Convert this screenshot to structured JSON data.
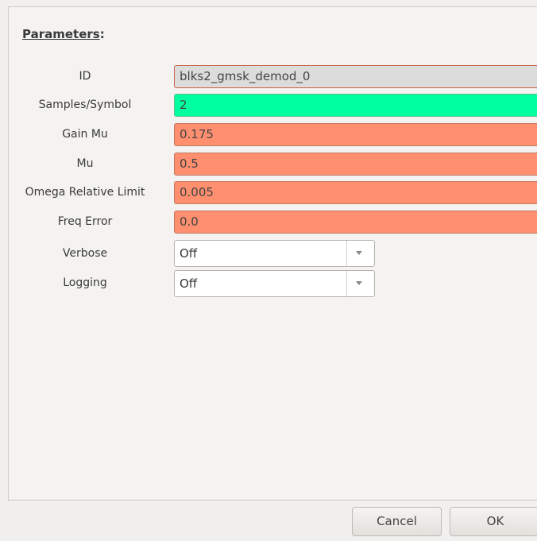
{
  "section_title_main": "Parameters",
  "section_title_colon": ":",
  "params": [
    {
      "label": "ID",
      "value": "blks2_gmsk_demod_0",
      "style": "id"
    },
    {
      "label": "Samples/Symbol",
      "value": "2",
      "style": "green"
    },
    {
      "label": "Gain Mu",
      "value": "0.175",
      "style": "orange"
    },
    {
      "label": "Mu",
      "value": "0.5",
      "style": "orange"
    },
    {
      "label": "Omega Relative Limit",
      "value": "0.005",
      "style": "orange"
    },
    {
      "label": "Freq Error",
      "value": "0.0",
      "style": "orange"
    }
  ],
  "verbose": {
    "label": "Verbose",
    "value": "Off"
  },
  "logging": {
    "label": "Logging",
    "value": "Off"
  },
  "buttons": {
    "cancel": "Cancel",
    "ok": "OK"
  },
  "colors": {
    "id_field": "#dcdcdc",
    "valid_field": "#00ff9f",
    "param_field": "#ff8f6f"
  },
  "icons": {
    "combo_arrow": "chevron-down-icon"
  }
}
